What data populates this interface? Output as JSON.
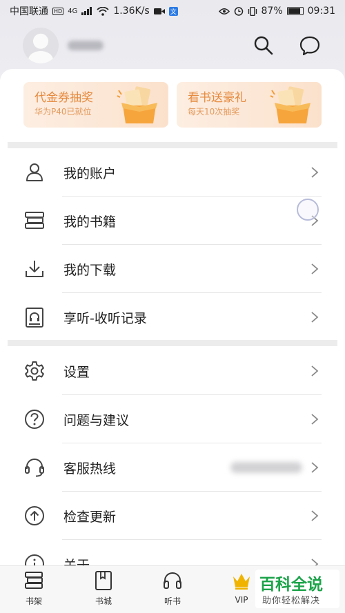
{
  "status_bar": {
    "carrier": "中国联通",
    "hd": "HD",
    "network": "4G",
    "speed": "1.36K/s",
    "battery": "87%",
    "time": "09:31",
    "badge": "文"
  },
  "header": {
    "search_icon": "search-icon",
    "message_icon": "message-icon"
  },
  "promos": [
    {
      "title": "代金券抽奖",
      "subtitle": "华为P40已就位"
    },
    {
      "title": "看书送豪礼",
      "subtitle": "每天10次抽奖"
    }
  ],
  "menu": {
    "account": "我的账户",
    "books": "我的书籍",
    "downloads": "我的下载",
    "listen_history": "享听-收听记录",
    "settings": "设置",
    "feedback": "问题与建议",
    "hotline": "客服热线",
    "update": "检查更新",
    "about": "关于"
  },
  "bottom_nav": {
    "bookshelf": "书架",
    "bookstore": "书城",
    "audiobook": "听书",
    "vip": "VIP"
  },
  "watermark": {
    "title": "百科全说",
    "subtitle": "助你轻松解决"
  },
  "colors": {
    "accent_orange": "#e58a3e",
    "watermark_green": "#1ca34a",
    "vip_gold": "#f0b400"
  }
}
